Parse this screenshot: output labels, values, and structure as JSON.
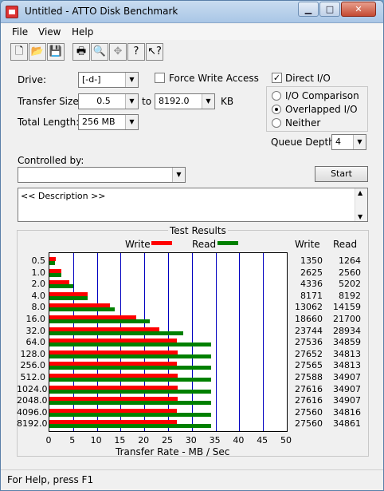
{
  "window": {
    "title": "Untitled - ATTO Disk Benchmark"
  },
  "menu": {
    "file": "File",
    "view": "View",
    "help": "Help"
  },
  "toolbar": {
    "icons": [
      "new-file-icon",
      "open-folder-icon",
      "save-icon",
      "print-icon",
      "print-preview-icon",
      "move-icon",
      "help-icon",
      "context-help-icon"
    ]
  },
  "settings": {
    "drive_label": "Drive:",
    "drive_value": "[-d-]",
    "force_write_label": "Force Write Access",
    "force_write_checked": false,
    "direct_io_label": "Direct I/O",
    "direct_io_checked": true,
    "transfer_size_label": "Transfer Size:",
    "transfer_from": "0.5",
    "to_label": "to",
    "transfer_to": "8192.0",
    "kb_label": "KB",
    "total_length_label": "Total Length:",
    "total_length_value": "256 MB",
    "io_comparison_label": "I/O Comparison",
    "overlapped_io_label": "Overlapped I/O",
    "neither_label": "Neither",
    "selected_mode": "Overlapped I/O",
    "queue_depth_label": "Queue Depth:",
    "queue_depth_value": "4",
    "controlled_by_label": "Controlled by:",
    "controlled_by_value": "",
    "start_label": "Start",
    "description_text": "<< Description >>"
  },
  "results": {
    "title": "Test Results",
    "write_legend": "Write",
    "read_legend": "Read",
    "write_col_header": "Write",
    "read_col_header": "Read",
    "write_color": "#ff0000",
    "read_color": "#008000"
  },
  "chart_data": {
    "type": "bar",
    "orientation": "horizontal",
    "categories": [
      "0.5",
      "1.0",
      "2.0",
      "4.0",
      "8.0",
      "16.0",
      "32.0",
      "64.0",
      "128.0",
      "256.0",
      "512.0",
      "1024.0",
      "2048.0",
      "4096.0",
      "8192.0"
    ],
    "series": [
      {
        "name": "Write",
        "color": "#ff0000",
        "values": [
          1350,
          2625,
          4336,
          8171,
          13062,
          18660,
          23744,
          27536,
          27652,
          27565,
          27588,
          27616,
          27616,
          27560,
          27560
        ]
      },
      {
        "name": "Read",
        "color": "#008000",
        "values": [
          1264,
          2560,
          5202,
          8192,
          14159,
          21700,
          28934,
          34859,
          34813,
          34813,
          34907,
          34907,
          34907,
          34816,
          34861
        ]
      }
    ],
    "xlabel": "Transfer Rate - MB / Sec",
    "xticks": [
      "0",
      "5",
      "10",
      "15",
      "20",
      "25",
      "30",
      "35",
      "40",
      "45",
      "50"
    ],
    "xlim": [
      0,
      50
    ],
    "grid": true
  },
  "status": {
    "text": "For Help, press F1"
  }
}
